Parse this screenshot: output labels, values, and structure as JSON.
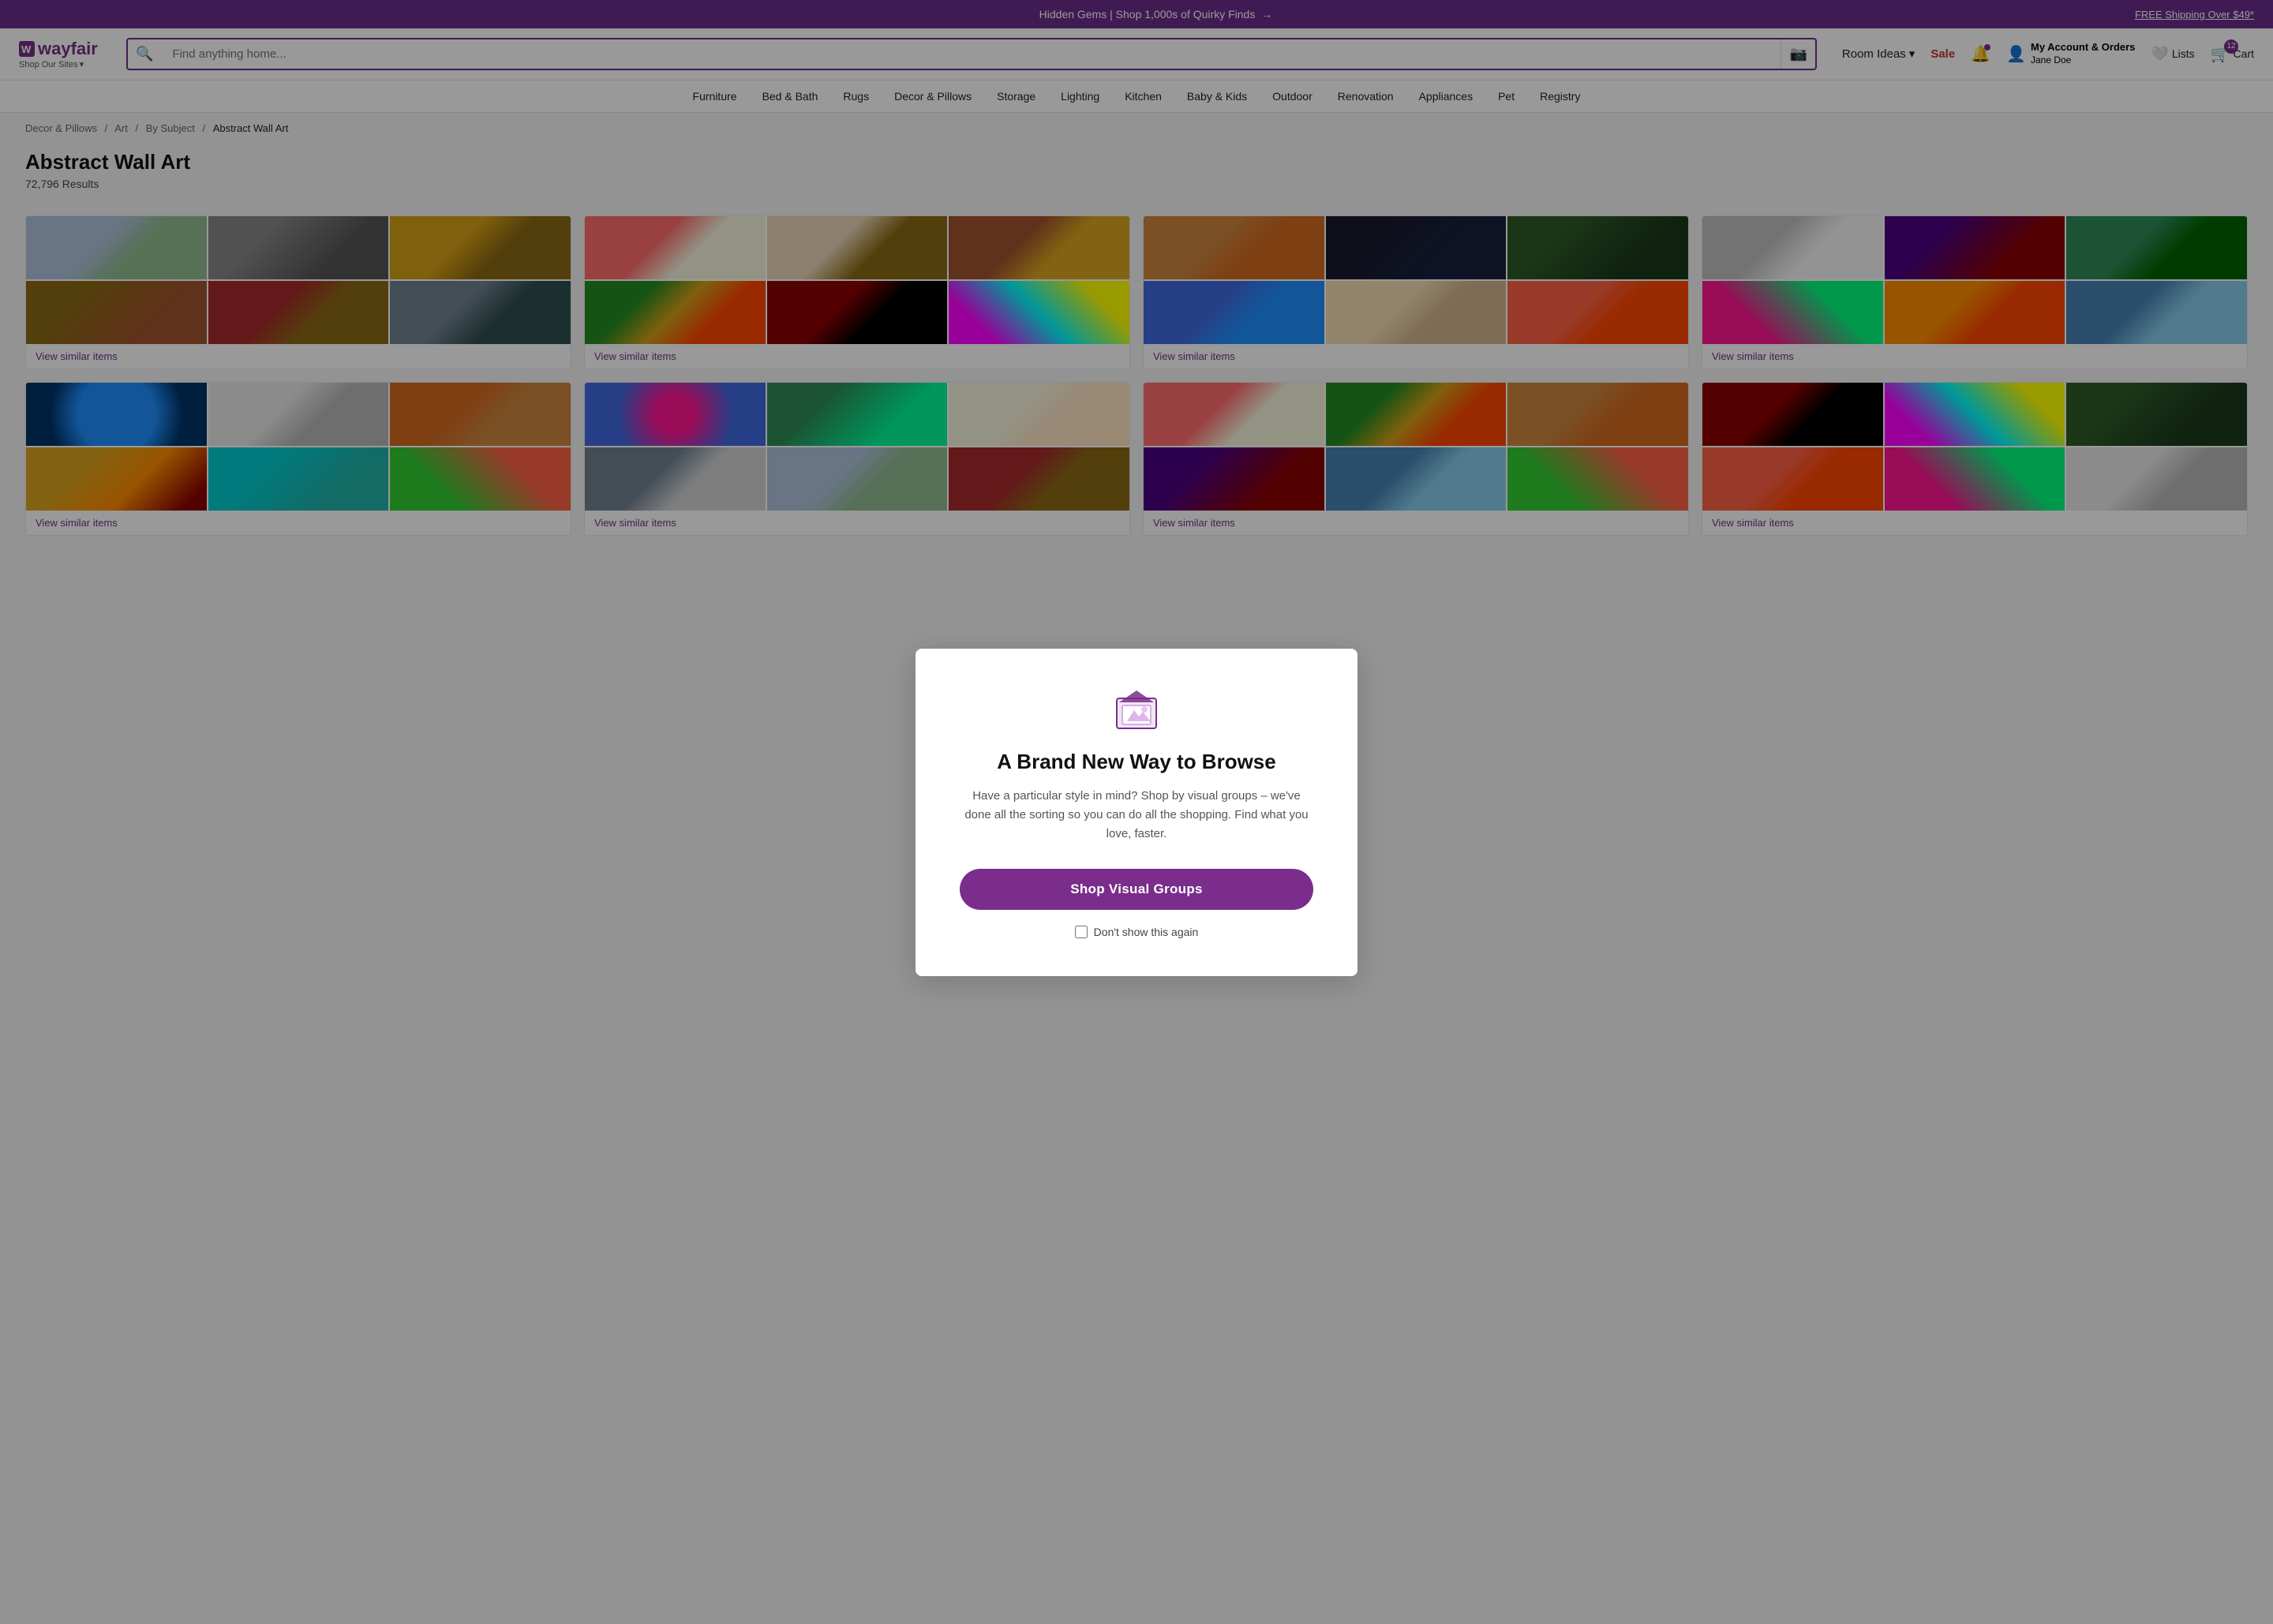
{
  "promo": {
    "text": "Hidden Gems | Shop 1,000s of Quirky Finds",
    "arrow": "→",
    "free_shipping": "FREE Shipping Over $49*"
  },
  "header": {
    "logo": "wayfair",
    "logo_sub": "Shop Our Sites",
    "search_placeholder": "Find anything home...",
    "room_ideas": "Room Ideas",
    "sale": "Sale",
    "account_label": "My Account & Orders",
    "account_name": "Jane Doe",
    "lists_label": "Lists",
    "cart_label": "Cart",
    "cart_count": "12"
  },
  "nav": {
    "items": [
      "Furniture",
      "Bed & Bath",
      "Rugs",
      "Decor & Pillows",
      "Storage",
      "Lighting",
      "Kitchen",
      "Baby & Kids",
      "Outdoor",
      "Renovation",
      "Appliances",
      "Pet",
      "Registry"
    ]
  },
  "breadcrumb": {
    "items": [
      "Decor & Pillows",
      "Art",
      "By Subject"
    ],
    "current": "Abstract Wall Art"
  },
  "page": {
    "title": "Abstract Wall Art",
    "results": "72,796 Results"
  },
  "modal": {
    "title": "A Brand New Way to Browse",
    "desc": "Have a particular style in mind? Shop by visual groups – we've done all the sorting so you can do all the shopping. Find what you love, faster.",
    "cta": "Shop Visual Groups",
    "checkbox_label": "Don't show this again"
  },
  "product_grid": {
    "cards": [
      {
        "id": 1,
        "footer": "View similar items",
        "swatches": [
          "swatch-1",
          "swatch-2",
          "swatch-3",
          "swatch-4",
          "swatch-5",
          "swatch-6"
        ]
      },
      {
        "id": 2,
        "footer": "View similar items",
        "swatches": [
          "swatch-7",
          "swatch-8",
          "swatch-9",
          "swatch-10",
          "swatch-11",
          "swatch-12"
        ]
      },
      {
        "id": 3,
        "footer": "View similar items",
        "swatches": [
          "swatch-13",
          "swatch-14",
          "swatch-15",
          "swatch-16",
          "swatch-17",
          "swatch-18"
        ]
      },
      {
        "id": 4,
        "footer": "View similar items",
        "swatches": [
          "swatch-19",
          "swatch-20",
          "swatch-21",
          "swatch-22",
          "swatch-23",
          "swatch-24"
        ]
      },
      {
        "id": 5,
        "footer": "View similar items",
        "swatches": [
          "swatch-25",
          "swatch-26",
          "swatch-27",
          "swatch-28",
          "swatch-29",
          "swatch-30"
        ]
      },
      {
        "id": 6,
        "footer": "View similar items",
        "swatches": [
          "swatch-31",
          "swatch-32",
          "swatch-33",
          "swatch-34",
          "swatch-1",
          "swatch-5"
        ]
      },
      {
        "id": 7,
        "footer": "View similar items",
        "swatches": [
          "swatch-7",
          "swatch-10",
          "swatch-13",
          "swatch-20",
          "swatch-24",
          "swatch-30"
        ]
      },
      {
        "id": 8,
        "footer": "View similar items",
        "swatches": [
          "swatch-11",
          "swatch-12",
          "swatch-15",
          "swatch-18",
          "swatch-22",
          "swatch-26"
        ]
      }
    ]
  }
}
